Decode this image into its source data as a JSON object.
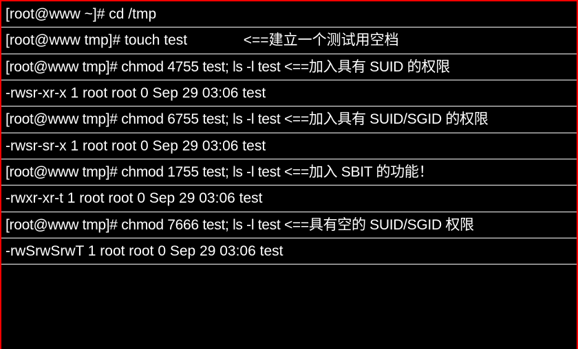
{
  "lines": [
    {
      "prompt": "[root@www ~]# ",
      "cmd": "cd /tmp",
      "comment": ""
    },
    {
      "prompt": "[root@www tmp]# ",
      "cmd": "touch test              ",
      "comment": "<==建立一个测试用空档"
    },
    {
      "prompt": "[root@www tmp]# ",
      "cmd": "chmod 4755 test; ls -l test ",
      "comment": "<==加入具有 SUID 的权限",
      "compact": true
    },
    {
      "output": "-rwsr-xr-x 1 root root 0 Sep 29 03:06 test"
    },
    {
      "prompt": "[root@www tmp]# ",
      "cmd": "chmod 6755 test; ls -l test ",
      "comment": "<==加入具有 SUID/SGID 的权限",
      "compact": true
    },
    {
      "output": "-rwsr-sr-x 1 root root 0 Sep 29 03:06 test"
    },
    {
      "prompt": "[root@www tmp]# ",
      "cmd": "chmod 1755 test; ls -l test ",
      "comment": "<==加入 SBIT 的功能！",
      "compact": true
    },
    {
      "output": "-rwxr-xr-t 1 root root 0 Sep 29 03:06 test"
    },
    {
      "prompt": "[root@www tmp]# ",
      "cmd": "chmod 7666 test; ls -l test ",
      "comment": "<==具有空的 SUID/SGID 权限",
      "compact": true
    },
    {
      "output": "-rwSrwSrwT 1 root root 0 Sep 29 03:06 test"
    }
  ]
}
